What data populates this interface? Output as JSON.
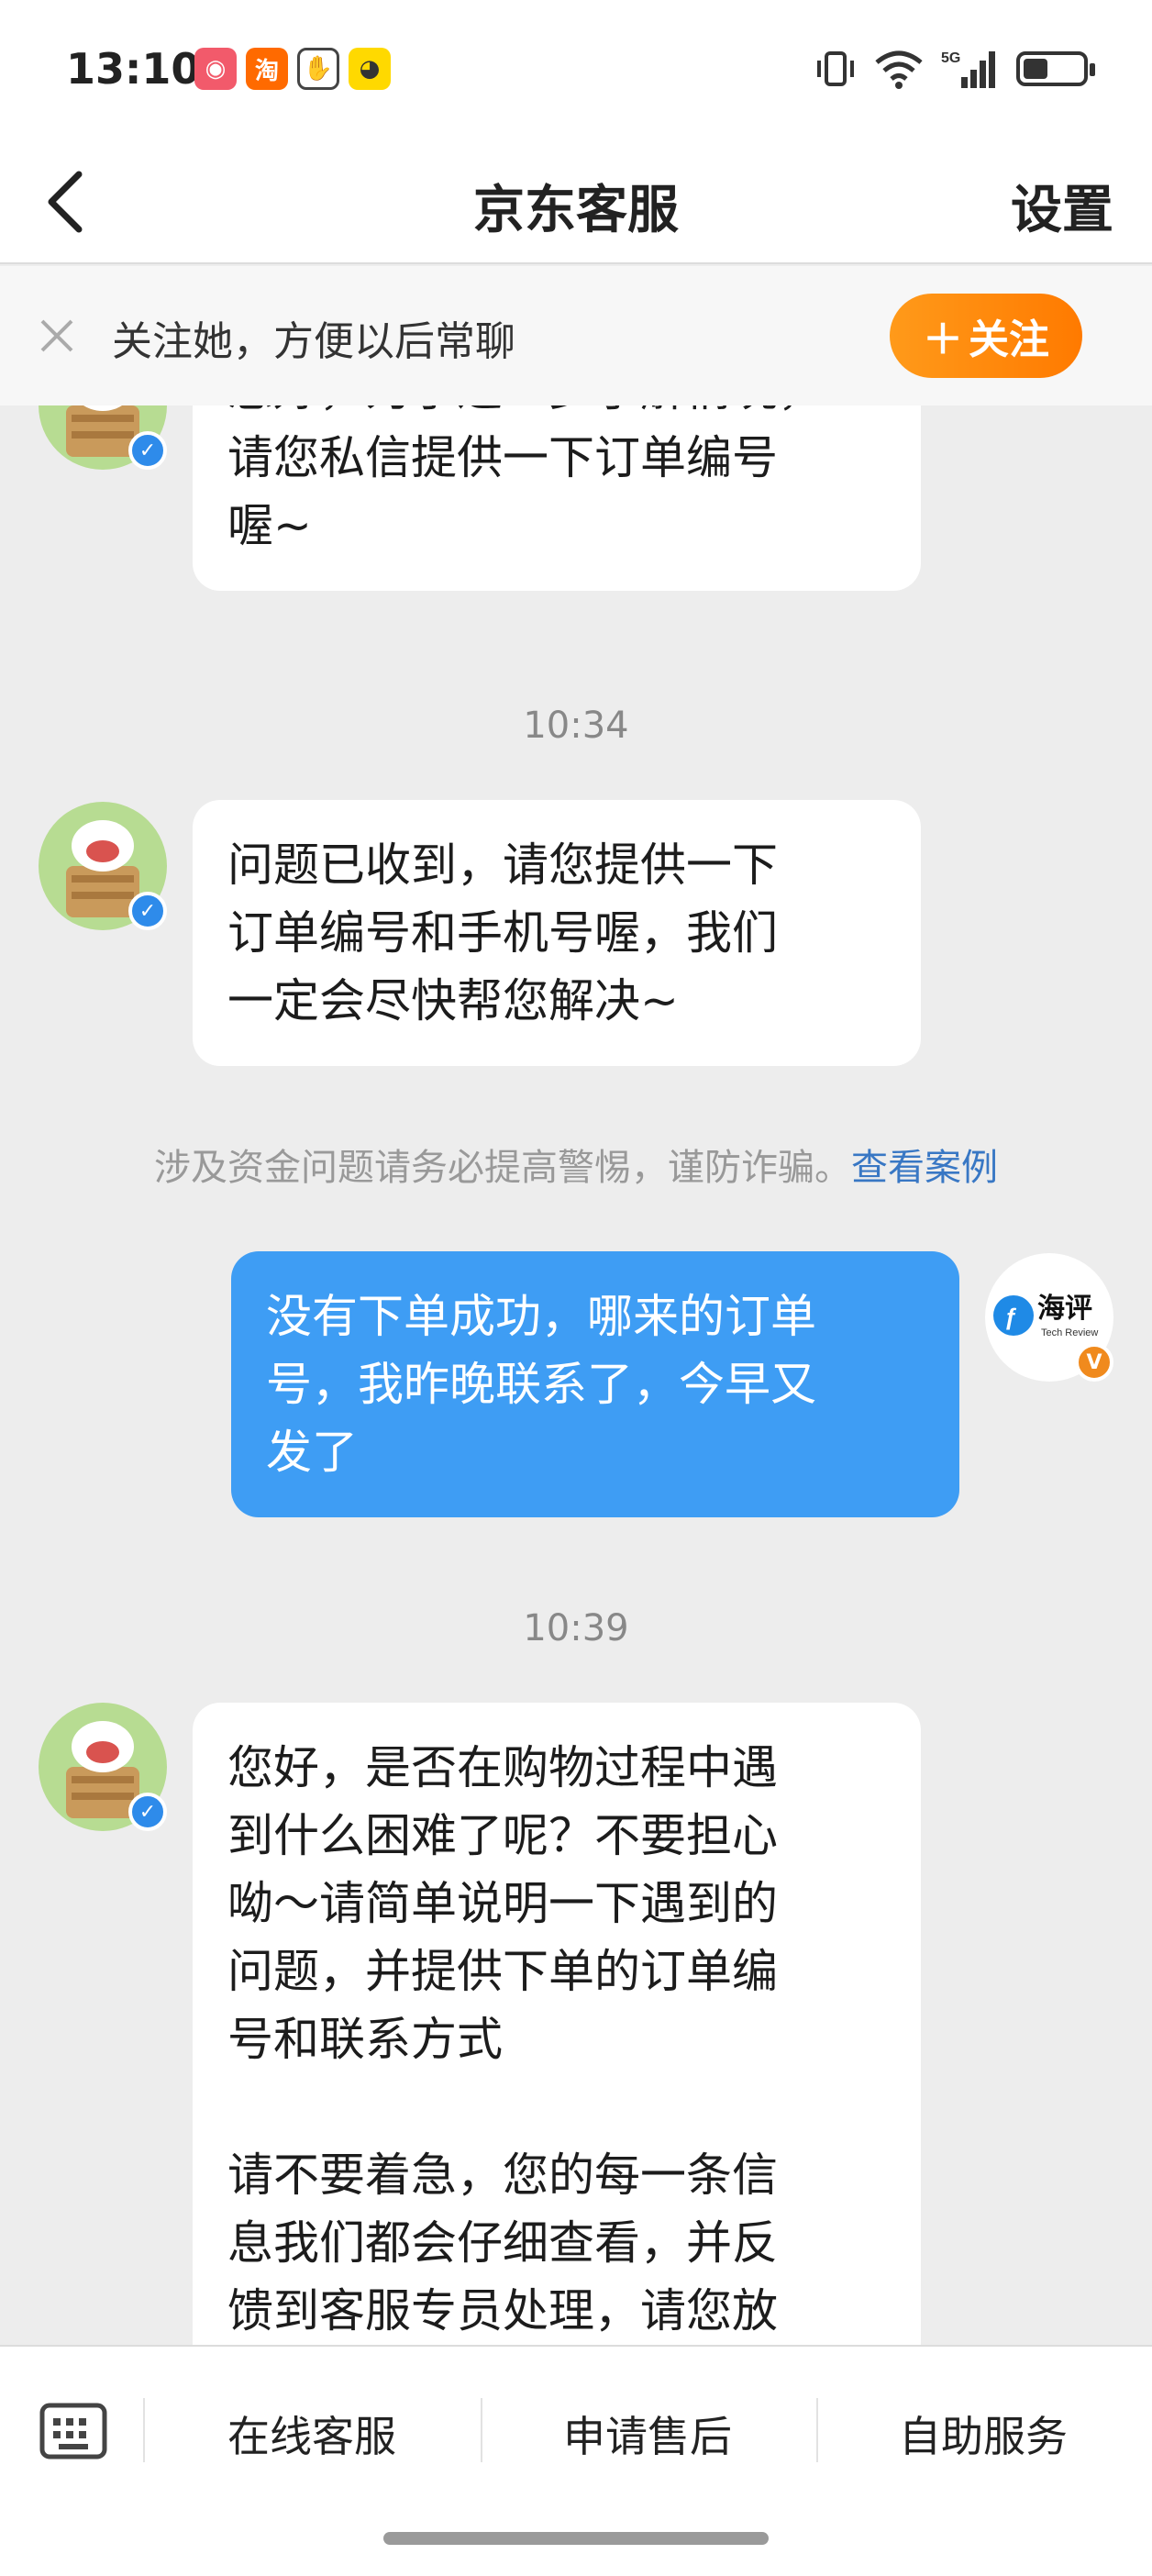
{
  "status_bar": {
    "time": "13:10",
    "notification_icons": [
      "app-icon-1",
      "taobao-icon",
      "hand-icon",
      "app-icon-4"
    ],
    "system_icons": [
      "vibrate-icon",
      "wifi-icon",
      "signal-5g-icon",
      "battery-icon"
    ]
  },
  "nav": {
    "title": "京东客服",
    "settings_label": "设置"
  },
  "follow_banner": {
    "text": "关注她，方便以后常聊",
    "button_label": "关注"
  },
  "chat": {
    "messages": [
      {
        "sender": "service",
        "text": "您好，为了进一步了解情况，\n请您私信提供一下订单编号\n喔~"
      },
      {
        "timestamp": "10:34"
      },
      {
        "sender": "service",
        "text": "问题已收到，请您提供一下\n订单编号和手机号喔，我们\n一定会尽快帮您解决~"
      },
      {
        "notice": "涉及资金问题请务必提高警惕，谨防诈骗。",
        "notice_link": "查看案例"
      },
      {
        "sender": "me",
        "text": "没有下单成功，哪来的订单\n号，我昨晚联系了，今早又\n发了"
      },
      {
        "timestamp": "10:39"
      },
      {
        "sender": "service",
        "text": "您好，是否在购物过程中遇\n到什么困难了呢？不要担心\n呦～请简单说明一下遇到的\n问题，并提供下单的订单编\n号和联系方式\n\n请不要着急，您的每一条信\n息我们都会仔细查看，并反\n馈到客服专员处理，请您放"
      }
    ],
    "me_avatar_text": "海评",
    "me_avatar_subtext": "Tech Review"
  },
  "bottom_bar": {
    "items": [
      "在线客服",
      "申请售后",
      "自助服务"
    ]
  },
  "colors": {
    "accent_orange": "#ff8c0a",
    "bubble_blue": "#3e9df4",
    "link_blue": "#3877c4"
  }
}
